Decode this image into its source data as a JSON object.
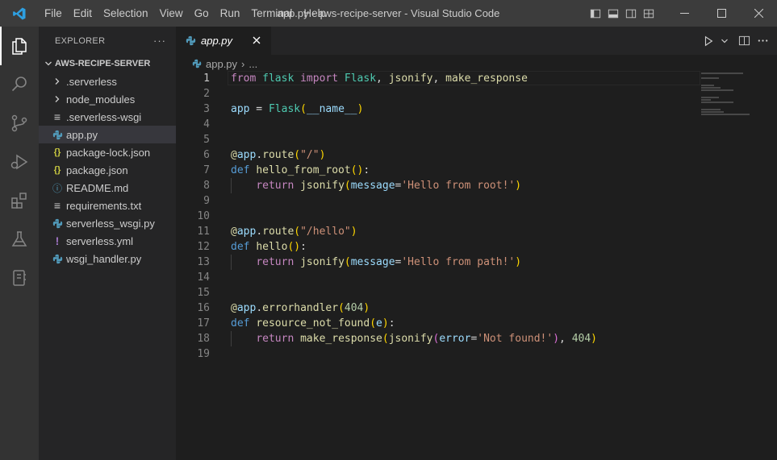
{
  "window": {
    "title": "app.py - aws-recipe-server - Visual Studio Code"
  },
  "menu": [
    "File",
    "Edit",
    "Selection",
    "View",
    "Go",
    "Run",
    "Terminal",
    "Help"
  ],
  "sidebar": {
    "header": "EXPLORER",
    "more_label": "···",
    "section": "AWS-RECIPE-SERVER",
    "items": [
      {
        "label": ".serverless",
        "icon": "chevron-right-icon",
        "glyph": "›",
        "color": "#cccccc"
      },
      {
        "label": "node_modules",
        "icon": "chevron-right-icon",
        "glyph": "›",
        "color": "#cccccc"
      },
      {
        "label": ".serverless-wsgi",
        "icon": "lines-icon",
        "glyph": "≡",
        "color": "#cccccc"
      },
      {
        "label": "app.py",
        "icon": "python-icon",
        "glyph": "",
        "color": "#519aba"
      },
      {
        "label": "package-lock.json",
        "icon": "json-icon",
        "glyph": "{}",
        "color": "#cbcb41"
      },
      {
        "label": "package.json",
        "icon": "json-icon",
        "glyph": "{}",
        "color": "#cbcb41"
      },
      {
        "label": "README.md",
        "icon": "info-icon",
        "glyph": "ⓘ",
        "color": "#519aba"
      },
      {
        "label": "requirements.txt",
        "icon": "lines-icon",
        "glyph": "≡",
        "color": "#cccccc"
      },
      {
        "label": "serverless_wsgi.py",
        "icon": "python-icon",
        "glyph": "",
        "color": "#519aba"
      },
      {
        "label": "serverless.yml",
        "icon": "exclamation-icon",
        "glyph": "!",
        "color": "#a074c4"
      },
      {
        "label": "wsgi_handler.py",
        "icon": "python-icon",
        "glyph": "",
        "color": "#519aba"
      }
    ]
  },
  "editor": {
    "tab_label": "app.py",
    "breadcrumb_file": "app.py",
    "breadcrumb_sep": "›",
    "breadcrumb_more": "...",
    "current_line": "1",
    "lines": [
      "1",
      "2",
      "3",
      "4",
      "5",
      "6",
      "7",
      "8",
      "9",
      "10",
      "11",
      "12",
      "13",
      "14",
      "15",
      "16",
      "17",
      "18",
      "19"
    ]
  },
  "colors": {
    "accent": "#007acc",
    "titlebar": "#3c3c3c",
    "sidebar": "#252526",
    "editor": "#1e1e1e"
  }
}
